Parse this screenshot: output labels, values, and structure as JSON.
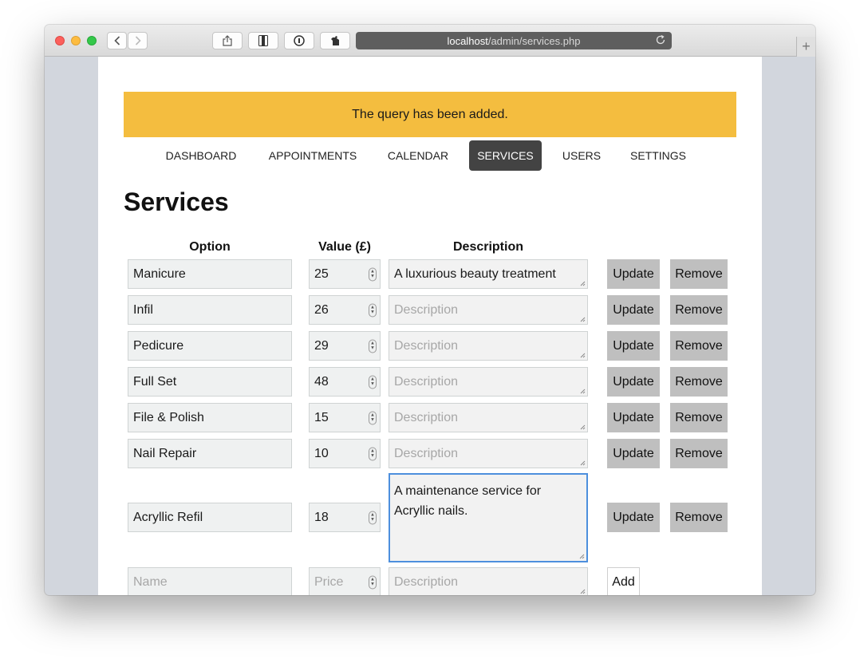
{
  "browser": {
    "url_host": "localhost",
    "url_path": "/admin/services.php",
    "icons": [
      "back-icon",
      "forward-icon",
      "share-icon",
      "reader-icon",
      "password-icon",
      "extension-icon",
      "reload-icon",
      "new-tab-icon"
    ]
  },
  "alert": {
    "message": "The query has been added.",
    "color": "#f4bd3f"
  },
  "nav": {
    "items": [
      "DASHBOARD",
      "APPOINTMENTS",
      "CALENDAR",
      "SERVICES",
      "USERS",
      "SETTINGS"
    ],
    "active": "SERVICES"
  },
  "page": {
    "title": "Services"
  },
  "table": {
    "headers": {
      "option": "Option",
      "value": "Value (£)",
      "description": "Description"
    },
    "rows": [
      {
        "name": "Manicure",
        "value": "25",
        "description": "A luxurious beauty treatment",
        "description_placeholder": "Description",
        "update": "Update",
        "remove": "Remove"
      },
      {
        "name": "Infil",
        "value": "26",
        "description": "",
        "description_placeholder": "Description",
        "update": "Update",
        "remove": "Remove"
      },
      {
        "name": "Pedicure",
        "value": "29",
        "description": "",
        "description_placeholder": "Description",
        "update": "Update",
        "remove": "Remove"
      },
      {
        "name": "Full Set",
        "value": "48",
        "description": "",
        "description_placeholder": "Description",
        "update": "Update",
        "remove": "Remove"
      },
      {
        "name": "File & Polish",
        "value": "15",
        "description": "",
        "description_placeholder": "Description",
        "update": "Update",
        "remove": "Remove"
      },
      {
        "name": "Nail Repair",
        "value": "10",
        "description": "",
        "description_placeholder": "Description",
        "update": "Update",
        "remove": "Remove"
      },
      {
        "name": "Acryllic Refil",
        "value": "18",
        "description": "A maintenance service for Acryllic nails.",
        "description_placeholder": "Description",
        "update": "Update",
        "remove": "Remove"
      }
    ],
    "new_row": {
      "name_placeholder": "Name",
      "price_placeholder": "Price",
      "description_placeholder": "Description",
      "add": "Add"
    }
  }
}
